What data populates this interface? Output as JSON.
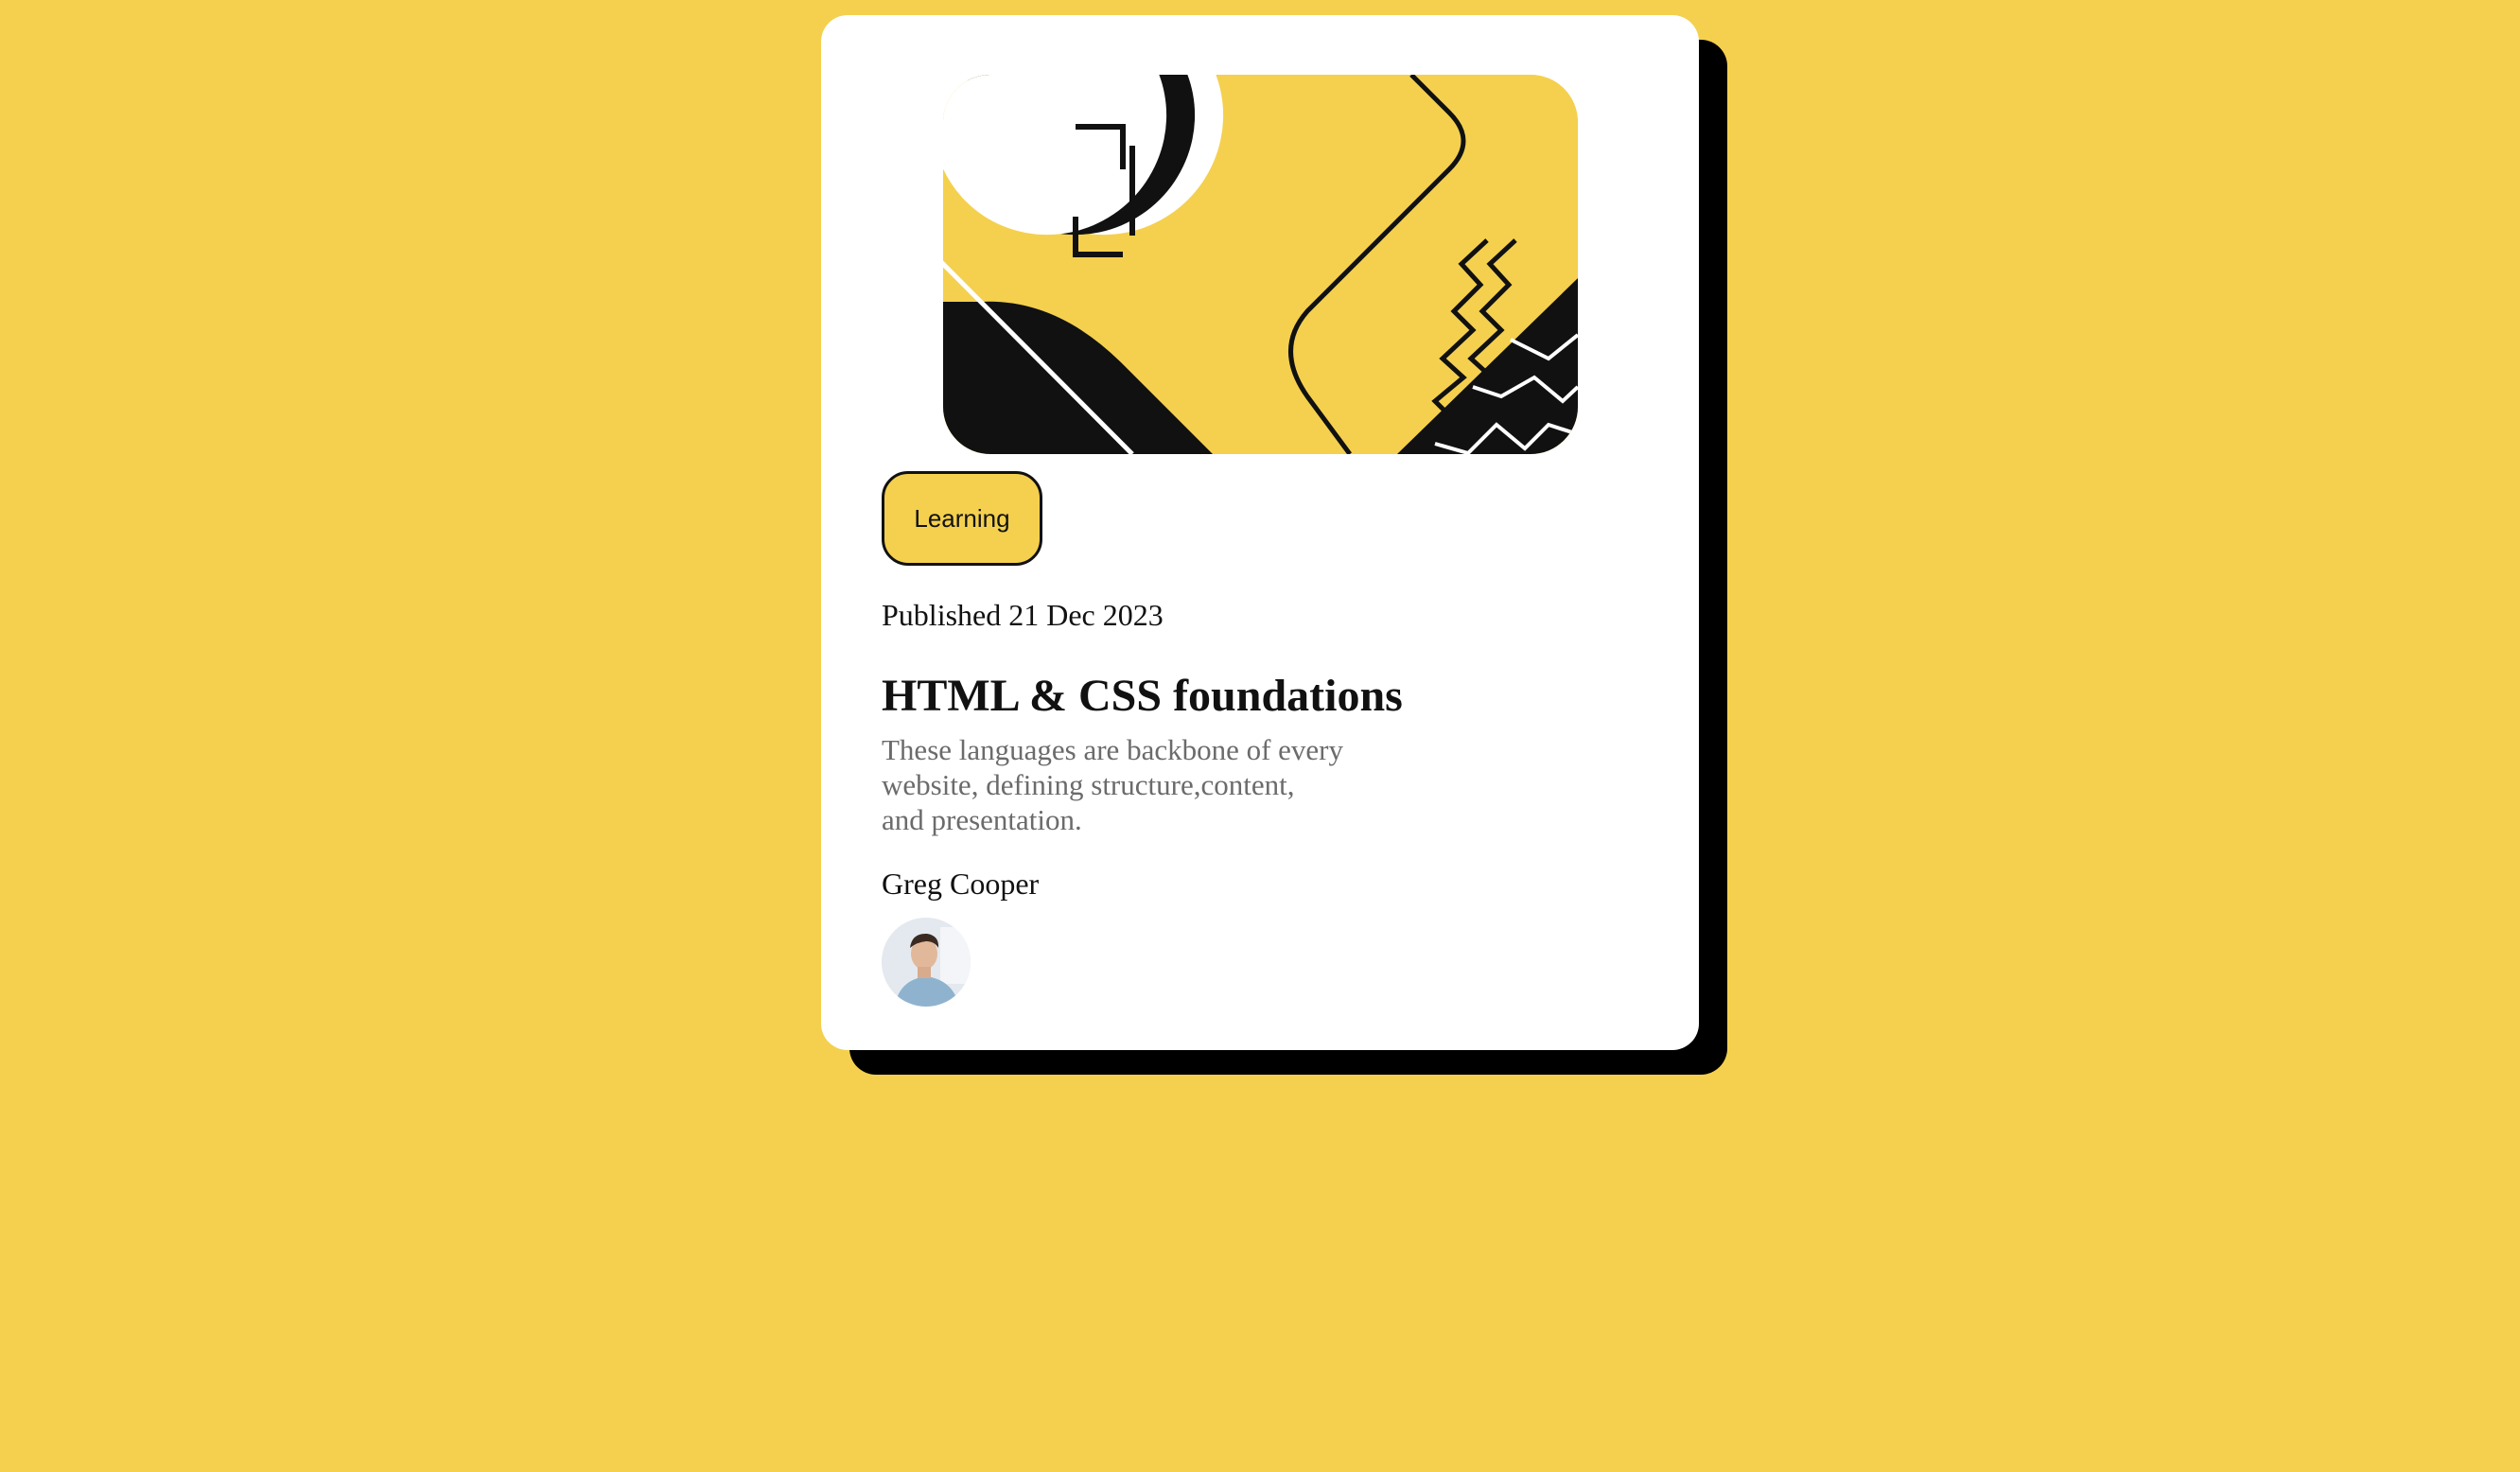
{
  "page": {
    "background_color": "#f4d04e"
  },
  "card": {
    "background_color": "#ffffff",
    "shadow_color": "#000000",
    "hero_image": "abstract-code-illustration",
    "badge_label": "Learning",
    "published": "Published 21 Dec 2023",
    "title": "HTML & CSS foundations",
    "description_lines": [
      "These languages are backbone of every",
      "website, defining structure,content,",
      "and presentation."
    ],
    "author": {
      "name": "Greg Cooper",
      "avatar": "author-portrait"
    }
  },
  "colors": {
    "accent_yellow": "#f4d04e",
    "text_dark": "#111111",
    "text_muted": "#6b6b6b"
  }
}
